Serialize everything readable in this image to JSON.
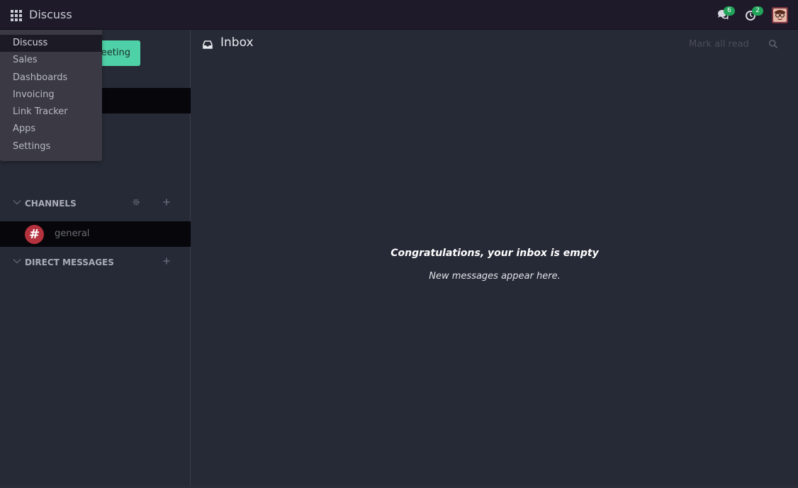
{
  "navbar": {
    "brand": "Discuss",
    "messages_badge": "6",
    "activities_badge": "2",
    "icons": [
      "apps-grid-icon",
      "chat-bubbles-icon",
      "clock-icon",
      "avatar"
    ]
  },
  "apps_menu": {
    "items": [
      {
        "label": "Discuss",
        "active": true
      },
      {
        "label": "Sales"
      },
      {
        "label": "Dashboards"
      },
      {
        "label": "Invoicing"
      },
      {
        "label": "Link Tracker"
      },
      {
        "label": "Apps"
      },
      {
        "label": "Settings"
      }
    ]
  },
  "sidebar": {
    "start_meeting_label": "eeting",
    "channels_header": "CHANNELS",
    "channel": {
      "symbol": "#",
      "label": "general"
    },
    "direct_messages_header": "DIRECT MESSAGES"
  },
  "main": {
    "title": "Inbox",
    "mark_all_read": "Mark all read",
    "empty_title": "Congratulations, your inbox is empty",
    "empty_subtitle": "New messages appear here."
  },
  "colors": {
    "navbar_bg": "#1e1a29",
    "body_bg": "#262a36",
    "accent_green": "#4fd1a7",
    "badge_green": "#21a35a",
    "channel_red": "#b4323e"
  }
}
